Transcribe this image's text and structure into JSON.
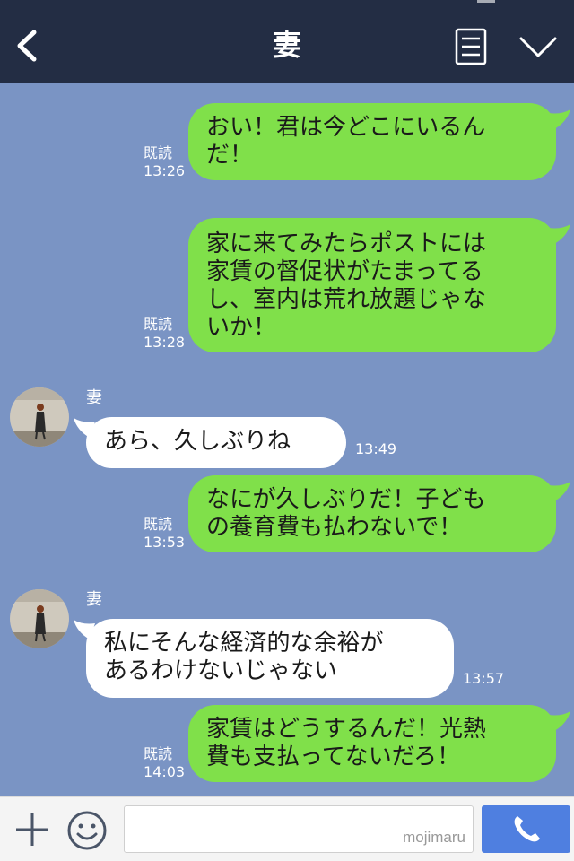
{
  "header": {
    "title": "妻"
  },
  "messages": [
    {
      "lines": [
        "おい！君は今どこにいるん",
        "だ！"
      ],
      "read": "既読",
      "time": "13:26"
    },
    {
      "lines": [
        "家に来てみたらポストには",
        "家賃の督促状がたまってる",
        "し、室内は荒れ放題じゃな",
        "いか！"
      ],
      "read": "既読",
      "time": "13:28"
    },
    {
      "sender": "妻",
      "lines": [
        "あら、久しぶりね"
      ],
      "time": "13:49"
    },
    {
      "lines": [
        "なにが久しぶりだ！子ども",
        "の養育費も払わないで！"
      ],
      "read": "既読",
      "time": "13:53"
    },
    {
      "sender": "妻",
      "lines": [
        "私にそんな経済的な余裕が",
        "あるわけないじゃない"
      ],
      "time": "13:57"
    },
    {
      "lines": [
        "家賃はどうするんだ！光熱",
        "費も支払ってないだろ！"
      ],
      "read": "既読",
      "time": "14:03"
    }
  ],
  "footer": {
    "watermark": "mojimaru"
  },
  "colors": {
    "header": "#232d44",
    "chat_background": "#7a94c4",
    "outgoing_bubble": "#80e04a",
    "incoming_bubble": "#ffffff",
    "call_button": "#4f7fe0"
  }
}
